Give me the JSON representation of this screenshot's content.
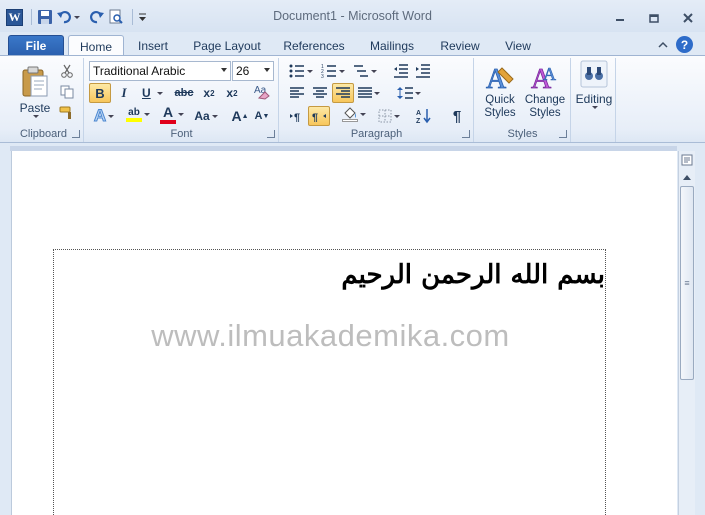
{
  "app": {
    "title": "Document1  -  Microsoft Word",
    "logo_letter": "W"
  },
  "qat": {
    "icons": [
      "word-logo",
      "save-icon",
      "undo-icon",
      "redo-icon",
      "print-preview-icon",
      "customize-qat-icon"
    ]
  },
  "tabs": [
    {
      "label": "File"
    },
    {
      "label": "Home"
    },
    {
      "label": "Insert"
    },
    {
      "label": "Page Layout"
    },
    {
      "label": "References"
    },
    {
      "label": "Mailings"
    },
    {
      "label": "Review"
    },
    {
      "label": "View"
    }
  ],
  "ribbon": {
    "clipboard": {
      "label": "Clipboard",
      "paste": "Paste"
    },
    "font": {
      "label": "Font",
      "font_name": "Traditional Arabic",
      "font_size": "26",
      "bold": "B",
      "italic": "I",
      "underline": "U",
      "strike": "abc",
      "subscript": "x",
      "subscript_mark": "2",
      "superscript": "x",
      "superscript_mark": "2",
      "text_effects": "A",
      "highlight": "ab",
      "font_color": "A",
      "change_case": "Aa",
      "grow": "A",
      "shrink": "A"
    },
    "paragraph": {
      "label": "Paragraph"
    },
    "styles": {
      "label": "Styles",
      "quick_styles": "Quick Styles",
      "change_styles": "Change Styles"
    },
    "editing": {
      "label": "Editing"
    }
  },
  "document": {
    "arabic_text": "بسم الله الرحمن الرحيم",
    "watermark": "www.ilmuakademika.com"
  },
  "colors": {
    "file_tab": "#2a5fae",
    "active_button": "#f7c65c",
    "watermark": "#bdbdbd"
  }
}
